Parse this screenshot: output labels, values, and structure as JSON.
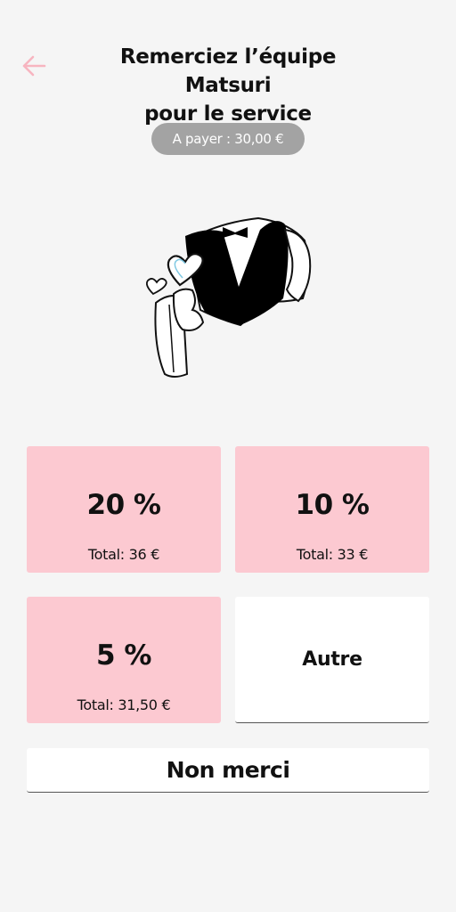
{
  "header": {
    "back_icon": "arrow-left-icon",
    "title_line1": "Remerciez l’équipe Matsuri",
    "title_line2": "pour le service",
    "accent_color": "#f7b5c0"
  },
  "amount_badge": {
    "label": "A payer : 30,00 €"
  },
  "illustration": {
    "icon": "waiter-heart-illustration"
  },
  "tips": [
    {
      "percent": "20 %",
      "total": "Total: 36 €"
    },
    {
      "percent": "10 %",
      "total": "Total: 33 €"
    },
    {
      "percent": "5 %",
      "total": "Total: 31,50 €"
    }
  ],
  "other_option": {
    "label": "Autre"
  },
  "decline_button": {
    "label": "Non merci"
  },
  "colors": {
    "background": "#f5f5f5",
    "tip_card": "#fcc9d1",
    "badge": "#a3a3a3"
  }
}
